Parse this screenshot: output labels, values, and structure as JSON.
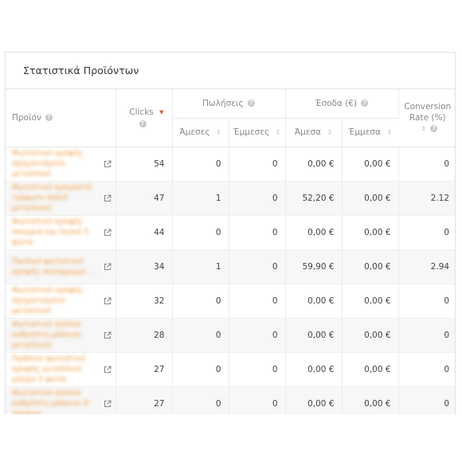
{
  "panel": {
    "title": "Στατιστικά Προϊόντων"
  },
  "columns": {
    "product": "Προϊόν",
    "clicks": "Clicks",
    "sales": "Πωλήσεις",
    "revenue": "Έσοδα (€)",
    "conversion": "Conversion Rate (%)",
    "direct_sales": "Άμεσες",
    "indirect_sales": "Έμμεσες",
    "direct_revenue": "Άμεσα",
    "indirect_revenue": "Έμμεσα"
  },
  "colors": {
    "link": "#f19a3e",
    "sort_active": "#e4573d"
  },
  "rows": [
    {
      "product": "Φωτιστικό οροφής σχηματισμένο μεταλλικό",
      "clicks": "54",
      "direct_sales": "0",
      "indirect_sales": "0",
      "direct_revenue": "0,00 €",
      "indirect_revenue": "0,00 €",
      "conversion": "0"
    },
    {
      "product": "Φωτιστικό κρεμαστό τρίφωτο παλιό μεταλλικό",
      "clicks": "47",
      "direct_sales": "1",
      "indirect_sales": "0",
      "direct_revenue": "52,20 €",
      "indirect_revenue": "0,00 €",
      "conversion": "2.12"
    },
    {
      "product": "Φωτιστικό οροφής σκουριά και λευκό 5 φώτα",
      "clicks": "44",
      "direct_sales": "0",
      "indirect_sales": "0",
      "direct_revenue": "0,00 €",
      "indirect_revenue": "0,00 €",
      "conversion": "0"
    },
    {
      "product": "Παιδικό φωτιστικό οροφής πολύχρωμο ...",
      "clicks": "34",
      "direct_sales": "1",
      "indirect_sales": "0",
      "direct_revenue": "59,90 €",
      "indirect_revenue": "0,00 €",
      "conversion": "2.94"
    },
    {
      "product": "Φωτιστικό οροφής σχηματισμένο μεταλλικό",
      "clicks": "32",
      "direct_sales": "0",
      "indirect_sales": "0",
      "direct_revenue": "0,00 €",
      "indirect_revenue": "0,00 €",
      "conversion": "0"
    },
    {
      "product": "Φωτιστικό απλίκα καθρέπτη μπάνιου μεταλλική",
      "clicks": "28",
      "direct_sales": "0",
      "indirect_sales": "0",
      "direct_revenue": "0,00 €",
      "indirect_revenue": "0,00 €",
      "conversion": "0"
    },
    {
      "product": "Πράσινο φωτιστικό οροφής μεταλλικό μαύρο 3 φώτα",
      "clicks": "27",
      "direct_sales": "0",
      "indirect_sales": "0",
      "direct_revenue": "0,00 €",
      "indirect_revenue": "0,00 €",
      "conversion": "0"
    },
    {
      "product": "Φωτιστικό απλίκα καθρέπτη μπάνιου 8 λαμπών",
      "clicks": "27",
      "direct_sales": "0",
      "indirect_sales": "0",
      "direct_revenue": "0,00 €",
      "indirect_revenue": "0,00 €",
      "conversion": "0"
    }
  ]
}
